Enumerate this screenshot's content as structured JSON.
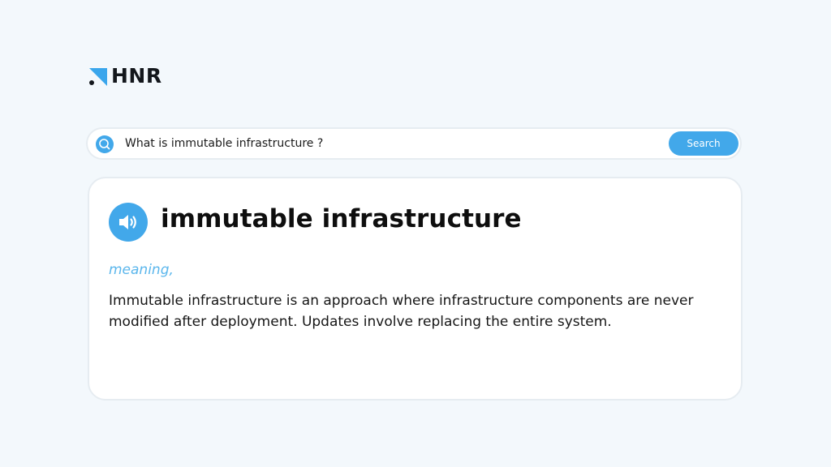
{
  "brand": {
    "name": "HNR",
    "accent_color": "#42a8ea",
    "icon": "hnr-logo-mark"
  },
  "search": {
    "query": "What is immutable infrastructure ?",
    "button_label": "Search",
    "icon": "search-icon"
  },
  "result": {
    "term": "immutable infrastructure",
    "meaning_label": "meaning,",
    "definition": "Immutable infrastructure is an approach where infrastructure components are never modified after deployment. Updates involve replacing the entire system.",
    "audio_icon": "speaker-icon"
  },
  "colors": {
    "background": "#f3f8fc",
    "card": "#ffffff",
    "accent": "#42a8ea",
    "meaning_label": "#5ab6ec",
    "text": "#161616"
  }
}
